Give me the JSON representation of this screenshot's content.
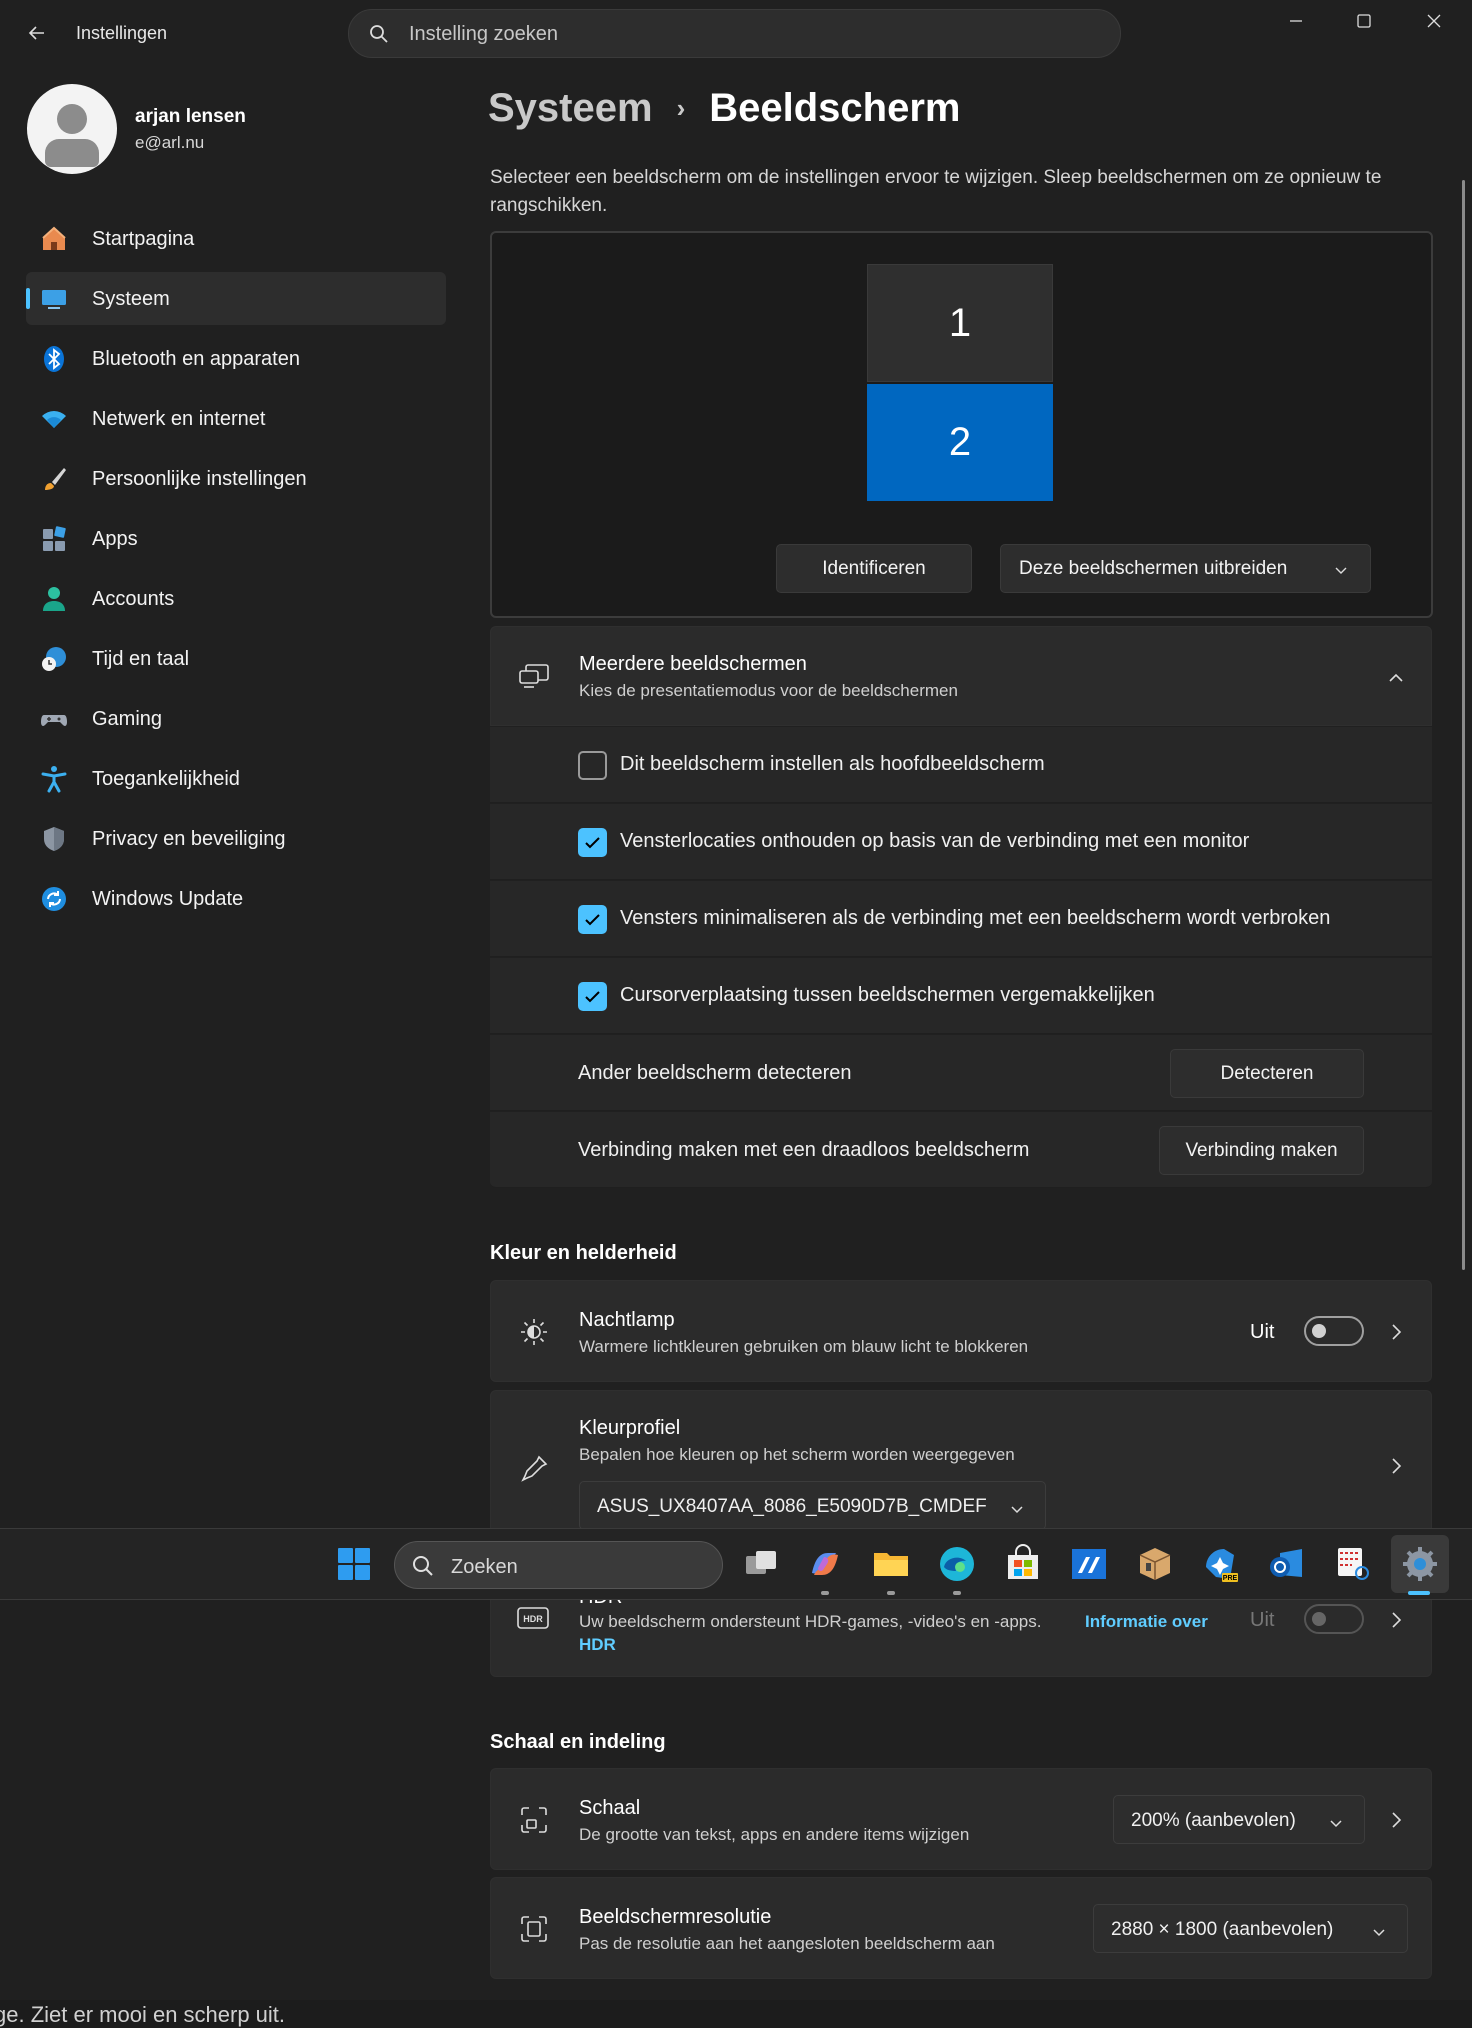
{
  "window": {
    "app_title": "Instellingen",
    "search_placeholder": "Instelling zoeken"
  },
  "profile": {
    "name": "arjan lensen",
    "email": "e@arl.nu"
  },
  "sidebar": {
    "items": [
      {
        "label": "Startpagina",
        "icon": "home-icon"
      },
      {
        "label": "Systeem",
        "icon": "monitor-icon",
        "active": true
      },
      {
        "label": "Bluetooth en apparaten",
        "icon": "bluetooth-icon"
      },
      {
        "label": "Netwerk en internet",
        "icon": "wifi-icon"
      },
      {
        "label": "Persoonlijke instellingen",
        "icon": "brush-icon"
      },
      {
        "label": "Apps",
        "icon": "apps-icon"
      },
      {
        "label": "Accounts",
        "icon": "person-icon"
      },
      {
        "label": "Tijd en taal",
        "icon": "globe-clock-icon"
      },
      {
        "label": "Gaming",
        "icon": "gamepad-icon"
      },
      {
        "label": "Toegankelijkheid",
        "icon": "accessibility-icon"
      },
      {
        "label": "Privacy en beveiliging",
        "icon": "shield-icon"
      },
      {
        "label": "Windows Update",
        "icon": "update-icon"
      }
    ]
  },
  "breadcrumb": {
    "parent": "Systeem",
    "separator": "›",
    "current": "Beeldscherm"
  },
  "intro_text": "Selecteer een beeldscherm om de instellingen ervoor te wijzigen. Sleep beeldschermen om ze opnieuw te rangschikken.",
  "arrangement": {
    "monitors": [
      "1",
      "2"
    ],
    "selected": "2",
    "identify_button": "Identificeren",
    "mode_dropdown": "Deze beeldschermen uitbreiden"
  },
  "multiple_displays": {
    "title": "Meerdere beeldschermen",
    "subtitle": "Kies de presentatiemodus voor de beeldschermen",
    "options": [
      {
        "label": "Dit beeldscherm instellen als hoofdbeeldscherm",
        "checked": false
      },
      {
        "label": "Vensterlocaties onthouden op basis van de verbinding met een monitor",
        "checked": true
      },
      {
        "label": "Vensters minimaliseren als de verbinding met een beeldscherm wordt verbroken",
        "checked": true
      },
      {
        "label": "Cursorverplaatsing tussen beeldschermen vergemakkelijken",
        "checked": true
      }
    ],
    "detect_label": "Ander beeldscherm detecteren",
    "detect_button": "Detecteren",
    "wireless_label": "Verbinding maken met een draadloos beeldscherm",
    "wireless_button": "Verbinding maken"
  },
  "color_section": {
    "heading": "Kleur en helderheid",
    "night_light": {
      "title": "Nachtlamp",
      "subtitle": "Warmere lichtkleuren gebruiken om blauw licht te blokkeren",
      "state": "Uit"
    },
    "color_profile": {
      "title": "Kleurprofiel",
      "subtitle": "Bepalen hoe kleuren op het scherm worden weergegeven",
      "value": "ASUS_UX8407AA_8086_E5090D7B_CMDEF"
    },
    "hdr": {
      "title": "HDR",
      "subtitle": "Uw beeldscherm ondersteunt HDR-games, -video's en -apps.",
      "link_part1": "Informatie over",
      "link_part2": "HDR",
      "state": "Uit"
    }
  },
  "scale_section": {
    "heading": "Schaal en indeling",
    "scale": {
      "title": "Schaal",
      "subtitle": "De grootte van tekst, apps en andere items wijzigen",
      "value": "200% (aanbevolen)"
    },
    "resolution": {
      "title": "Beeldschermresolutie",
      "subtitle": "Pas de resolutie aan het aangesloten beeldscherm aan",
      "value": "2880 × 1800 (aanbevolen)"
    }
  },
  "taskbar": {
    "search_label": "Zoeken",
    "apps": [
      "start-icon",
      "task-view-icon",
      "copilot-icon",
      "file-explorer-icon",
      "edge-icon",
      "store-icon",
      "vscode-icon",
      "package-icon",
      "copilot-pre-icon",
      "outlook-icon",
      "snipping-tool-icon",
      "settings-icon"
    ]
  },
  "bottom_caption": "ge. Ziet er mooi en scherp uit."
}
